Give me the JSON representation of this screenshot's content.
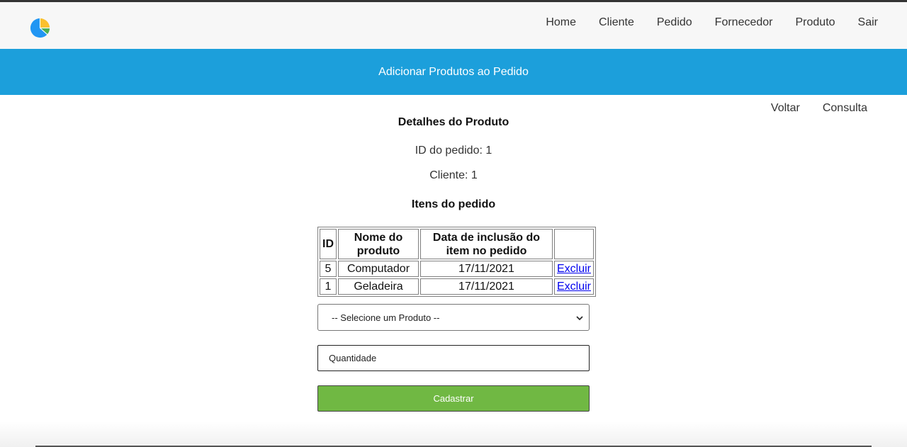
{
  "app": {
    "logo": {
      "icon": "pie-chart-logo-icon",
      "colors": [
        "#2196f3",
        "#fbc02d",
        "#4caf50"
      ]
    }
  },
  "nav": {
    "items": [
      {
        "label": "Home"
      },
      {
        "label": "Cliente"
      },
      {
        "label": "Pedido"
      },
      {
        "label": "Fornecedor"
      },
      {
        "label": "Produto"
      },
      {
        "label": "Sair"
      }
    ]
  },
  "banner": {
    "title": "Adicionar Produtos ao Pedido",
    "color": "#1c9fdb"
  },
  "subnav": {
    "back_label": "Voltar",
    "query_label": "Consulta"
  },
  "details": {
    "heading": "Detalhes do Produto",
    "order_id_text": "ID do pedido: 1",
    "client_text": "Cliente: 1",
    "items_heading": "Itens do pedido"
  },
  "table": {
    "headers": [
      "ID",
      "Nome do produto",
      "Data de inclusão do item no pedido",
      ""
    ],
    "rows": [
      {
        "id": "5",
        "name": "Computador",
        "date": "17/11/2021",
        "action": "Excluir"
      },
      {
        "id": "1",
        "name": "Geladeira",
        "date": "17/11/2021",
        "action": "Excluir"
      }
    ]
  },
  "form": {
    "product_select": {
      "selected": "-- Selecione um Produto --"
    },
    "quantity": {
      "placeholder": "Quantidade",
      "value": ""
    },
    "submit_label": "Cadastrar",
    "submit_color": "#70b843"
  }
}
